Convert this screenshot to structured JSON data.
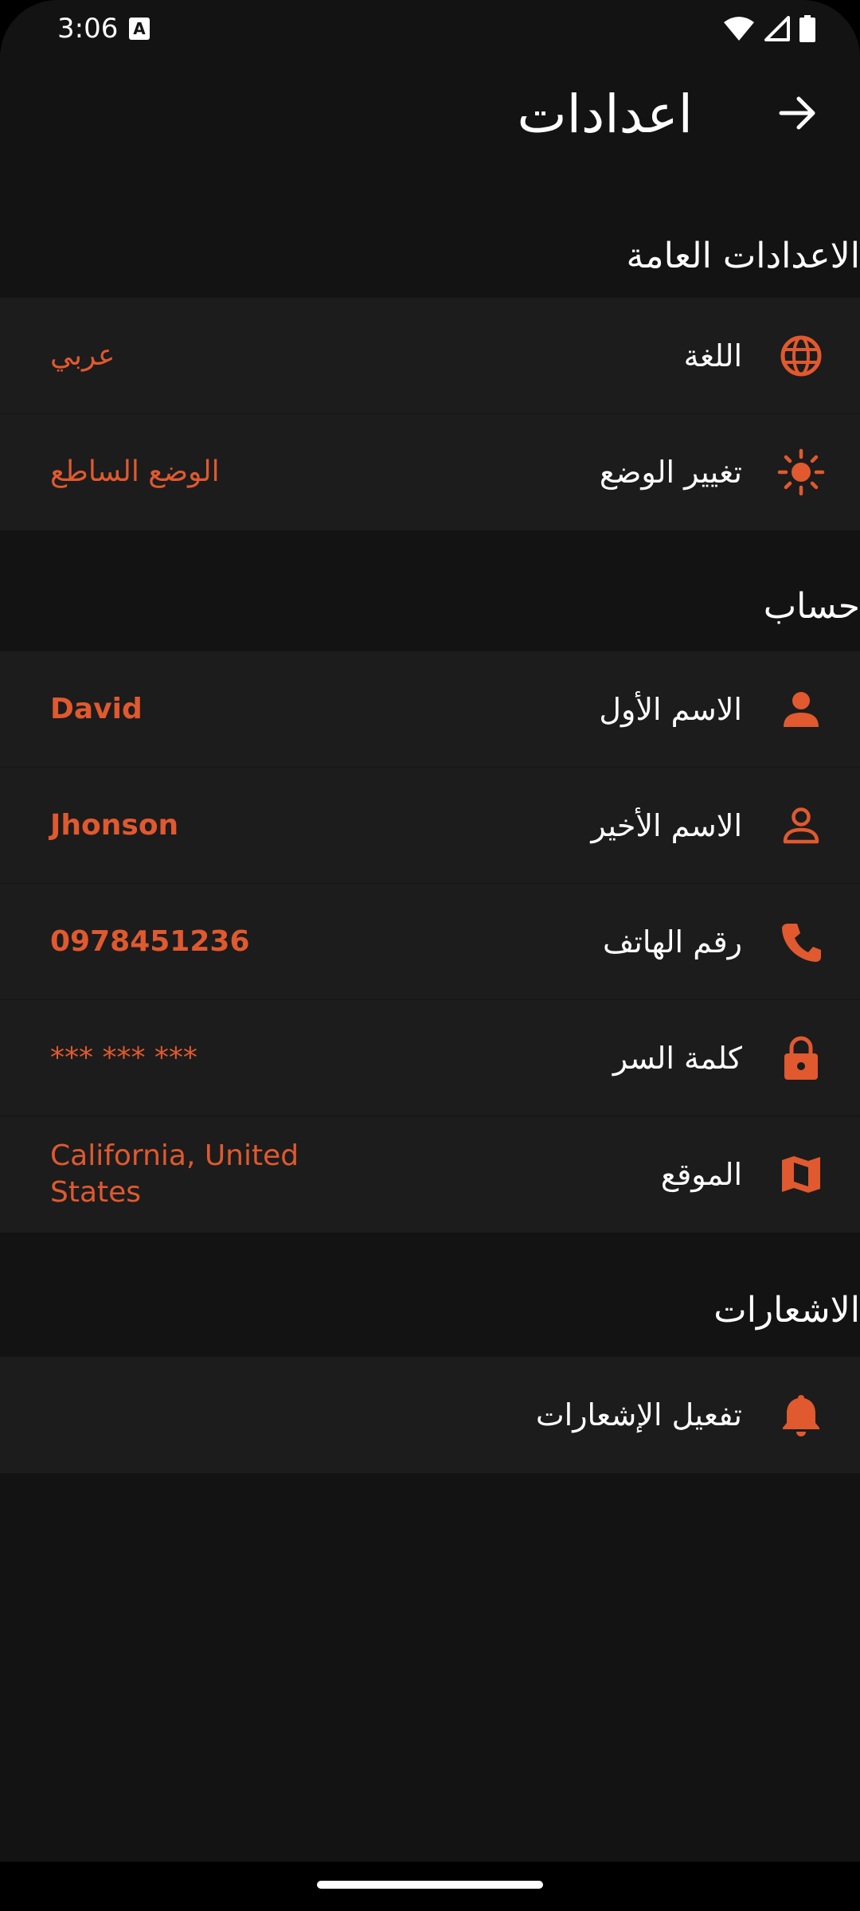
{
  "status_bar": {
    "time": "3:06",
    "a_badge": "A"
  },
  "app_bar": {
    "title": "اعدادات",
    "back_icon": "arrow-forward-icon"
  },
  "colors": {
    "background": "#131313",
    "row_background": "#1c1c1c",
    "accent": "#e0592f",
    "text": "#ffffff"
  },
  "sections": {
    "general": {
      "title": "الاعدادات العامة",
      "items": [
        {
          "icon": "globe-icon",
          "label": "اللغة",
          "value": "عربي"
        },
        {
          "icon": "sun-icon",
          "label": "تغيير الوضع",
          "value": "الوضع الساطع"
        }
      ]
    },
    "account": {
      "title": "حساب",
      "items": [
        {
          "icon": "person-icon",
          "label": "الاسم الأول",
          "value": "David"
        },
        {
          "icon": "person-outline-icon",
          "label": "الاسم الأخير",
          "value": "Jhonson"
        },
        {
          "icon": "phone-icon",
          "label": "رقم الهاتف",
          "value": "0978451236"
        },
        {
          "icon": "lock-icon",
          "label": "كلمة السر",
          "value": "*** *** ***"
        },
        {
          "icon": "map-icon",
          "label": "الموقع",
          "value": "California, United States"
        }
      ]
    },
    "notifications": {
      "title": "الاشعارات",
      "items": [
        {
          "icon": "bell-icon",
          "label": "تفعيل الإشعارات"
        }
      ]
    }
  }
}
